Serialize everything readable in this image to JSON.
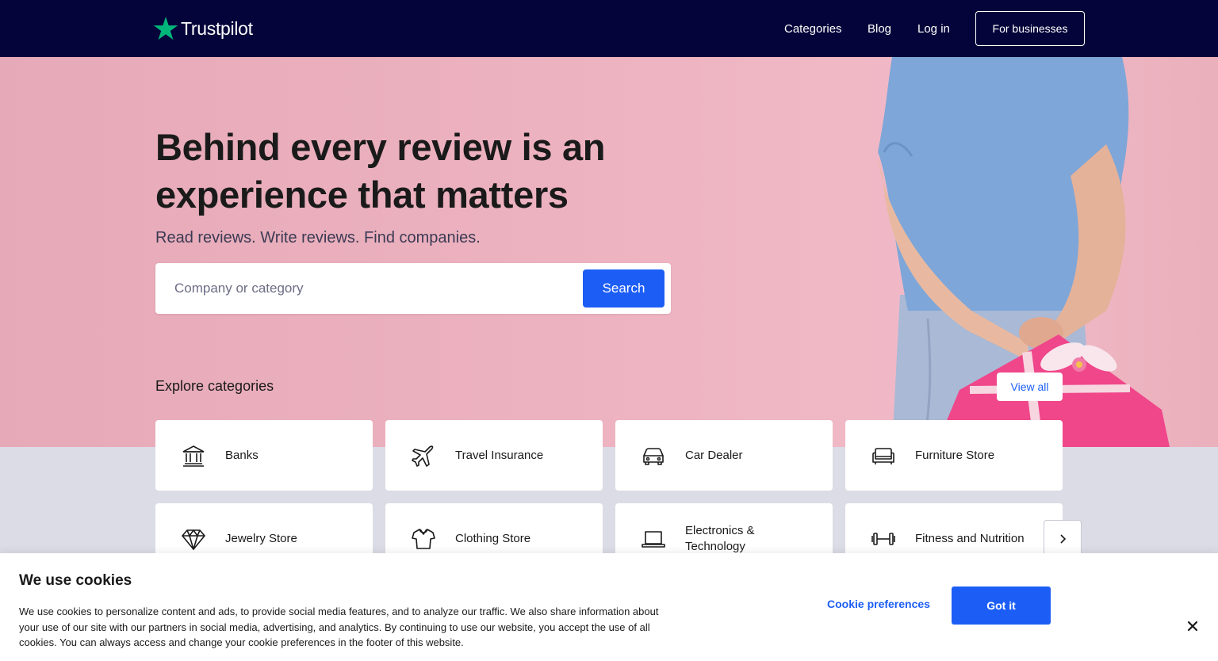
{
  "header": {
    "brand": "Trustpilot",
    "nav": [
      {
        "label": "Categories"
      },
      {
        "label": "Blog"
      },
      {
        "label": "Log in"
      }
    ],
    "cta_label": "For businesses"
  },
  "hero": {
    "headline": "Behind every review is an experience that matters",
    "subheadline": "Read reviews. Write reviews. Find companies.",
    "search": {
      "placeholder": "Company or category",
      "value": "",
      "button_label": "Search"
    }
  },
  "categories": {
    "title": "Explore categories",
    "view_all_label": "View all",
    "items": [
      {
        "label": "Banks",
        "icon": "bank-icon"
      },
      {
        "label": "Travel Insurance",
        "icon": "airplane-icon"
      },
      {
        "label": "Car Dealer",
        "icon": "car-icon"
      },
      {
        "label": "Furniture Store",
        "icon": "sofa-icon"
      },
      {
        "label": "Jewelry Store",
        "icon": "diamond-icon"
      },
      {
        "label": "Clothing Store",
        "icon": "shirt-icon"
      },
      {
        "label": "Electronics & Technology",
        "icon": "laptop-icon"
      },
      {
        "label": "Fitness and Nutrition",
        "icon": "dumbbell-icon"
      }
    ]
  },
  "cookie_banner": {
    "title": "We use cookies",
    "text": "We use cookies to personalize content and ads, to provide social media features, and to analyze our traffic. We also share information about your use of our site with our partners in social media, advertising, and analytics. By continuing to use our website, you accept the use of all cookies. You can always access and change your cookie preferences in the footer of this website.",
    "preferences_label": "Cookie preferences",
    "accept_label": "Got it"
  },
  "colors": {
    "header_bg": "#04043a",
    "brand_star": "#00b67a",
    "accent_blue": "#1c5ef5",
    "hero_pink": "#eeb4c2"
  }
}
